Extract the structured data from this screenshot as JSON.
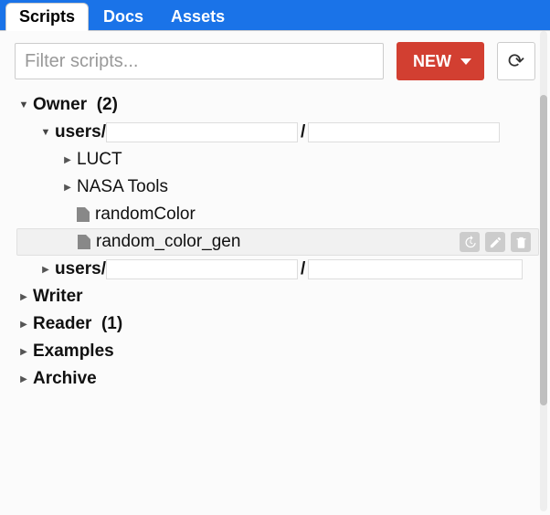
{
  "tabs": {
    "scripts": "Scripts",
    "docs": "Docs",
    "assets": "Assets"
  },
  "toolbar": {
    "filter_placeholder": "Filter scripts...",
    "new_label": "NEW"
  },
  "tree": {
    "owner": {
      "label": "Owner",
      "count": "(2)"
    },
    "users1_prefix": "users/",
    "luct": "LUCT",
    "nasa_tools": "NASA Tools",
    "random_color": "randomColor",
    "random_color_gen": "random_color_gen",
    "users2_prefix": "users/",
    "writer": "Writer",
    "reader": {
      "label": "Reader",
      "count": "(1)"
    },
    "examples": "Examples",
    "archive": "Archive"
  }
}
